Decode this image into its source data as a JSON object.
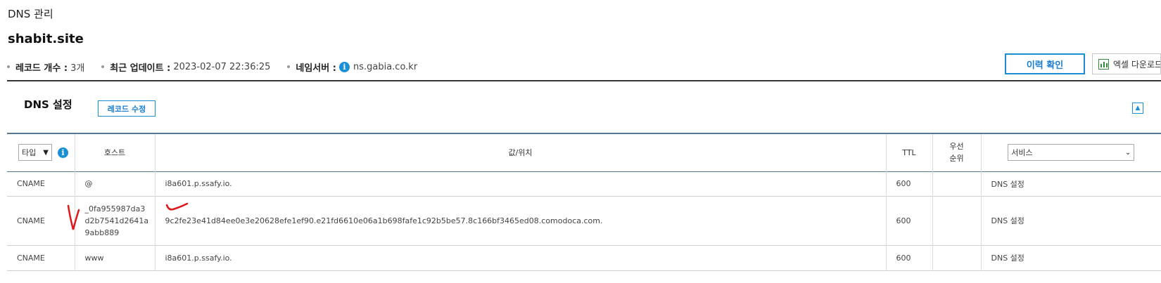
{
  "breadcrumb": "DNS 관리",
  "domain": "shabit.site",
  "meta": {
    "record_count_label": "레코드 개수 :",
    "record_count_value": "3개",
    "last_update_label": "최근 업데이트 :",
    "last_update_value": "2023-02-07 22:36:25",
    "nameserver_label": "네임서버 :",
    "nameserver_icon": "i",
    "nameserver_value": "ns.gabia.co.kr"
  },
  "buttons": {
    "history": "이력 확인",
    "excel": "엑셀 다운로드"
  },
  "section": {
    "title": "DNS 설정",
    "edit_button": "레코드 수정",
    "collapse_icon": "▲"
  },
  "table": {
    "type_select": "타입",
    "type_info_icon": "i",
    "headers": {
      "host": "호스트",
      "value": "값/위치",
      "ttl": "TTL",
      "priority": "우선\n순위"
    },
    "service_select": "서비스",
    "rows": [
      {
        "type": "CNAME",
        "host": "@",
        "value": "i8a601.p.ssafy.io.",
        "ttl": "600",
        "priority": "",
        "service": "DNS 설정"
      },
      {
        "type": "CNAME",
        "host": "_0fa955987da3d2b7541d2641a9abb889",
        "value": "9c2fe23e41d84ee0e3e20628efe1ef90.e21fd6610e06a1b698fafe1c92b5be57.8c166bf3465ed08.comodoca.com.",
        "ttl": "600",
        "priority": "",
        "service": "DNS 설정"
      },
      {
        "type": "CNAME",
        "host": "www",
        "value": "i8a601.p.ssafy.io.",
        "ttl": "600",
        "priority": "",
        "service": "DNS 설정"
      }
    ]
  },
  "colors": {
    "accent": "#1a8fd6",
    "annotation": "#e0161b",
    "excel_green": "#2e8b3a"
  }
}
